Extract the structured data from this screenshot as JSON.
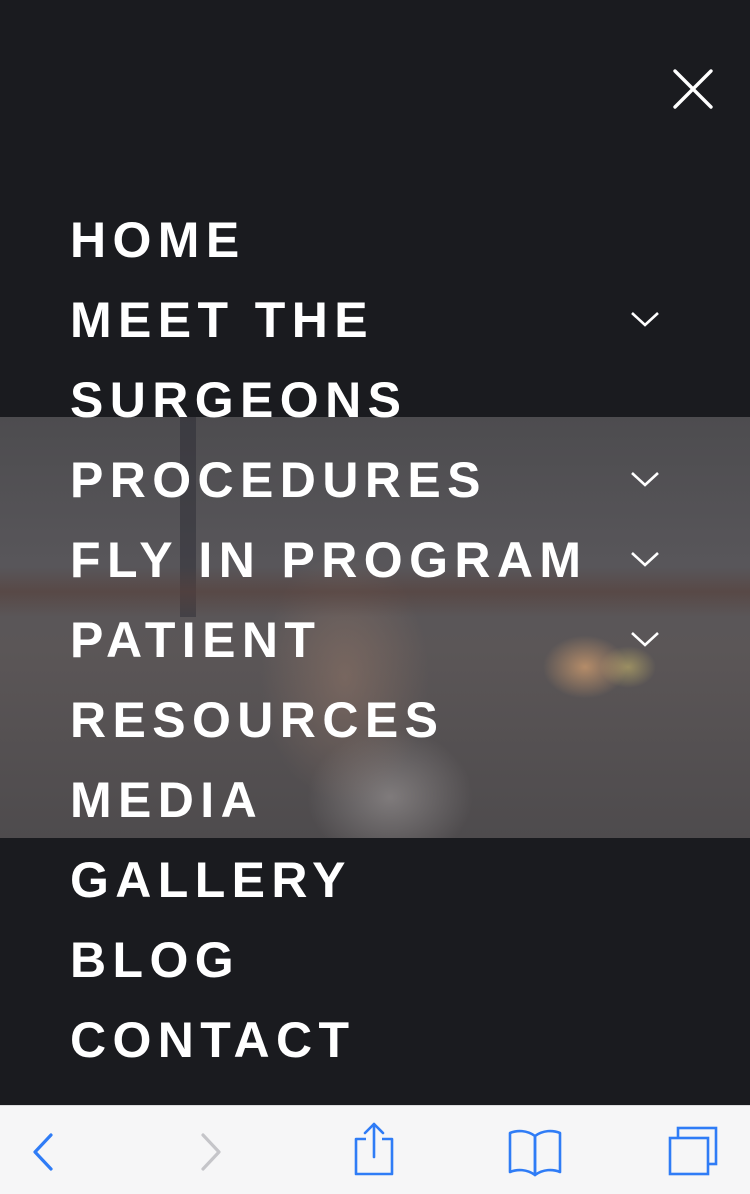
{
  "menu": {
    "items": [
      {
        "label": "HOME",
        "has_submenu": false
      },
      {
        "label": "MEET THE\nSURGEONS",
        "has_submenu": true
      },
      {
        "label": "PROCEDURES",
        "has_submenu": true
      },
      {
        "label": "FLY IN PROGRAM",
        "has_submenu": true
      },
      {
        "label": "PATIENT\nRESOURCES",
        "has_submenu": true
      },
      {
        "label": "MEDIA",
        "has_submenu": false
      },
      {
        "label": "GALLERY",
        "has_submenu": false
      },
      {
        "label": "BLOG",
        "has_submenu": false
      },
      {
        "label": "CONTACT",
        "has_submenu": false
      }
    ]
  },
  "icons": {
    "close": "close-icon",
    "submenu": "chevron-down-icon",
    "back": "back-arrow-icon",
    "forward": "forward-arrow-icon",
    "share": "share-icon",
    "bookmarks": "bookmarks-icon",
    "tabs": "tabs-icon"
  },
  "colors": {
    "background": "#1a1b1f",
    "text": "#ffffff",
    "toolbar_bg": "#f6f6f7",
    "toolbar_active": "#2f7cf6",
    "toolbar_disabled": "#c5c5c9"
  }
}
